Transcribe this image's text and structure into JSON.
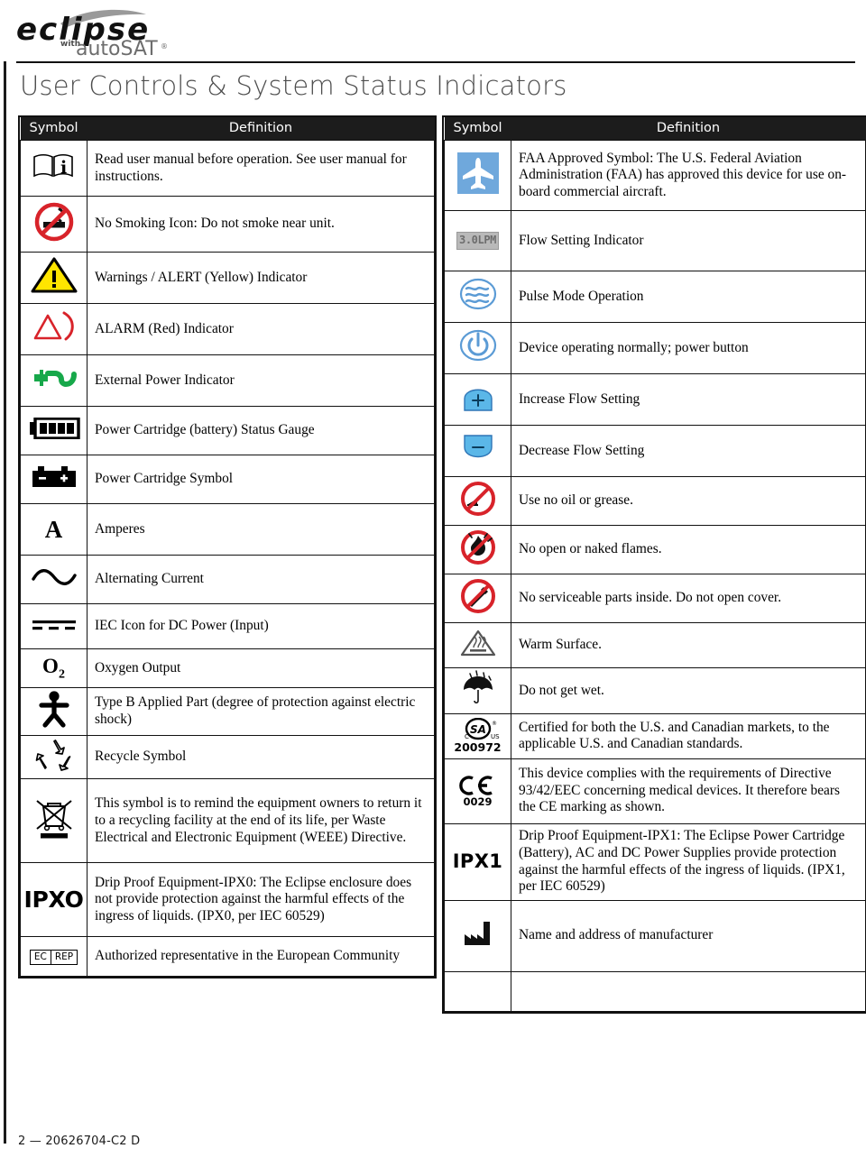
{
  "brand": {
    "logo_main": "eclipse",
    "logo_with": "with",
    "logo_sub": "autoSAT",
    "logo_registered": "®"
  },
  "page_title": "User Controls & System Status Indicators",
  "footer": "2  —  20626704-C2 D",
  "columns": {
    "symbol": "Symbol",
    "definition": "Definition"
  },
  "colors": {
    "header_bg": "#1c1c1c",
    "alert_yellow": "#FFE500",
    "alarm_red": "#D8232A",
    "external_power_green": "#17A84A",
    "button_blue": "#5BB7E8",
    "faa_blue": "#6FA8DC",
    "prohibition_red": "#D8232A",
    "lcd_grey": "#b9b9b9"
  },
  "left_table": {
    "rows": [
      {
        "icon": "read-manual-icon",
        "text": "Read user manual before operation. See user manual for instructions."
      },
      {
        "icon": "no-smoking-icon",
        "text": "No Smoking Icon: Do not smoke near unit."
      },
      {
        "icon": "warning-alert-triangle-icon",
        "text": "Warnings / ALERT (Yellow) Indicator"
      },
      {
        "icon": "alarm-bell-triangle-icon",
        "text": "ALARM (Red) Indicator"
      },
      {
        "icon": "external-power-plug-icon",
        "text": "External Power Indicator"
      },
      {
        "icon": "battery-status-gauge-icon",
        "text": "Power Cartridge (battery) Status Gauge"
      },
      {
        "icon": "power-cartridge-battery-icon",
        "text": "Power Cartridge Symbol"
      },
      {
        "icon": "amperes-letter-a",
        "text": "Amperes",
        "glyph": "A"
      },
      {
        "icon": "alternating-current-icon",
        "text": "Alternating Current"
      },
      {
        "icon": "dc-power-input-icon",
        "text": "IEC Icon for DC Power (Input)"
      },
      {
        "icon": "oxygen-output-icon",
        "text": "Oxygen Output",
        "glyph": "O",
        "glyph_sub": "2"
      },
      {
        "icon": "type-b-applied-part-icon",
        "text": "Type B Applied Part (degree of protection against electric shock)"
      },
      {
        "icon": "recycle-icon",
        "text": "Recycle Symbol"
      },
      {
        "icon": "weee-crossed-bin-icon",
        "text": "This symbol is to remind the equipment owners to return it to a recycling facility at the end of its life, per Waste Electrical and Electronic Equipment (WEEE) Directive."
      },
      {
        "icon": "ipx0-text-icon",
        "text": "Drip Proof Equipment-IPX0: The Eclipse enclosure does not provide protection against the harmful effects of the ingress of liquids. (IPX0, per IEC 60529)",
        "glyph": "IPXO"
      },
      {
        "icon": "ec-rep-icon",
        "text": "Authorized representative in the European Community",
        "glyph_a": "EC",
        "glyph_b": "REP"
      }
    ]
  },
  "right_table": {
    "rows": [
      {
        "icon": "faa-airplane-icon",
        "text": "FAA Approved Symbol: The U.S. Federal Aviation Administration (FAA) has approved this device for use on-board commercial aircraft."
      },
      {
        "icon": "flow-setting-lcd-icon",
        "text": "Flow Setting Indicator",
        "glyph": "3.0LPM"
      },
      {
        "icon": "pulse-mode-waves-icon",
        "text": "Pulse Mode Operation"
      },
      {
        "icon": "power-button-icon",
        "text": "Device operating normally; power button"
      },
      {
        "icon": "increase-flow-plus-button-icon",
        "text": "Increase Flow Setting"
      },
      {
        "icon": "decrease-flow-minus-button-icon",
        "text": "Decrease Flow Setting"
      },
      {
        "icon": "no-oil-or-grease-icon",
        "text": "Use no oil or grease."
      },
      {
        "icon": "no-open-flames-icon",
        "text": "No open or naked flames."
      },
      {
        "icon": "no-serviceable-parts-icon",
        "text": "No serviceable parts inside. Do not open cover."
      },
      {
        "icon": "warm-surface-icon",
        "text": "Warm Surface."
      },
      {
        "icon": "do-not-get-wet-umbrella-icon",
        "text": "Do not get wet."
      },
      {
        "icon": "csa-certification-icon",
        "text": "Certified for both the U.S. and Canadian markets, to the applicable U.S. and Canadian standards.",
        "glyph_num": "200972",
        "glyph_c": "C",
        "glyph_us": "US"
      },
      {
        "icon": "ce-marking-icon",
        "text": "This device complies with the requirements of Directive 93/42/EEC concerning medical devices. It therefore bears the CE marking as shown.",
        "glyph_num": "0029"
      },
      {
        "icon": "ipx1-text-icon",
        "text": "Drip Proof Equipment-IPX1: The Eclipse Power Cartridge (Battery), AC and DC Power Supplies provide protection against the harmful effects of the ingress of liquids. (IPX1, per IEC 60529)",
        "glyph": "IPX1"
      },
      {
        "icon": "manufacturer-factory-icon",
        "text": "Name and address of manufacturer"
      },
      {
        "icon": "empty-icon",
        "text": ""
      }
    ]
  }
}
